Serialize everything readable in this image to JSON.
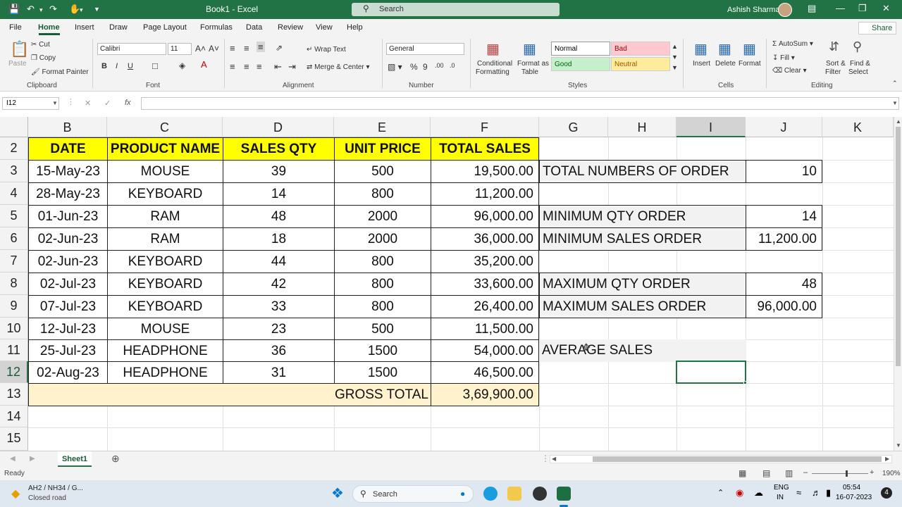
{
  "window": {
    "title": "Book1 - Excel",
    "search_placeholder": "Search",
    "user": "Ashish Sharma",
    "quick_access": [
      "save-icon",
      "undo-icon",
      "redo-icon",
      "touch-mode-icon",
      "customize-icon"
    ]
  },
  "ribbon_tabs": [
    "File",
    "Home",
    "Insert",
    "Draw",
    "Page Layout",
    "Formulas",
    "Data",
    "Review",
    "View",
    "Help"
  ],
  "active_tab": "Home",
  "share_label": "Share",
  "ribbon": {
    "clipboard": {
      "paste": "Paste",
      "cut": "Cut",
      "copy": "Copy",
      "format_painter": "Format Painter",
      "group": "Clipboard"
    },
    "font": {
      "name": "Calibri",
      "size": "11",
      "group": "Font",
      "bold": "B",
      "italic": "I",
      "underline": "U"
    },
    "alignment": {
      "wrap_text": "Wrap Text",
      "merge_center": "Merge & Center",
      "group": "Alignment"
    },
    "number": {
      "format": "General",
      "group": "Number"
    },
    "styles": {
      "conditional_formatting": [
        "Conditional",
        "Formatting"
      ],
      "format_as_table": [
        "Format as",
        "Table"
      ],
      "normal": "Normal",
      "bad": "Bad",
      "good": "Good",
      "neutral": "Neutral",
      "group": "Styles"
    },
    "cells": {
      "insert": "Insert",
      "delete": "Delete",
      "format": "Format",
      "group": "Cells"
    },
    "editing": {
      "autosum": "AutoSum",
      "fill": "Fill",
      "clear": "Clear",
      "sort_filter": [
        "Sort &",
        "Filter"
      ],
      "find_select": [
        "Find &",
        "Select"
      ],
      "group": "Editing"
    },
    "colors": {
      "bad_bg": "#ffc7ce",
      "good_bg": "#c6efce",
      "neutral_bg": "#ffeb9c"
    }
  },
  "formula_bar": {
    "name_box": "I12",
    "fx": "fx",
    "content": ""
  },
  "columns": [
    "B",
    "C",
    "D",
    "E",
    "F",
    "G",
    "H",
    "I",
    "J",
    "K"
  ],
  "rows": [
    "2",
    "3",
    "4",
    "5",
    "6",
    "7",
    "8",
    "9",
    "10",
    "11",
    "12",
    "13",
    "14",
    "15"
  ],
  "selected_cell": "I12",
  "table": {
    "headers": [
      "DATE",
      "PRODUCT NAME",
      "SALES QTY",
      "UNIT PRICE",
      "TOTAL SALES"
    ],
    "rows": [
      [
        "15-May-23",
        "MOUSE",
        "39",
        "500",
        "19,500.00"
      ],
      [
        "28-May-23",
        "KEYBOARD",
        "14",
        "800",
        "11,200.00"
      ],
      [
        "01-Jun-23",
        "RAM",
        "48",
        "2000",
        "96,000.00"
      ],
      [
        "02-Jun-23",
        "RAM",
        "18",
        "2000",
        "36,000.00"
      ],
      [
        "02-Jun-23",
        "KEYBOARD",
        "44",
        "800",
        "35,200.00"
      ],
      [
        "02-Jul-23",
        "KEYBOARD",
        "42",
        "800",
        "33,600.00"
      ],
      [
        "07-Jul-23",
        "KEYBOARD",
        "33",
        "800",
        "26,400.00"
      ],
      [
        "12-Jul-23",
        "MOUSE",
        "23",
        "500",
        "11,500.00"
      ],
      [
        "25-Jul-23",
        "HEADPHONE",
        "36",
        "1500",
        "54,000.00"
      ],
      [
        "02-Aug-23",
        "HEADPHONE",
        "31",
        "1500",
        "46,500.00"
      ]
    ],
    "gross_total_label": "GROSS TOTAL",
    "gross_total_value": "3,69,900.00"
  },
  "summary": {
    "total_orders_label": "TOTAL NUMBERS OF ORDER",
    "total_orders_value": "10",
    "min_qty_label": "MINIMUM QTY ORDER",
    "min_qty_value": "14",
    "min_sales_label": "MINIMUM SALES ORDER",
    "min_sales_value": "11,200.00",
    "max_qty_label": "MAXIMUM QTY ORDER",
    "max_qty_value": "48",
    "max_sales_label": "MAXIMUM SALES ORDER",
    "max_sales_value": "96,000.00",
    "avg_sales_label": "AVERAGE SALES"
  },
  "sheets": [
    "Sheet1"
  ],
  "status": {
    "ready": "Ready",
    "zoom": "190%"
  },
  "taskbar": {
    "weather_title": "AH2 / NH34 / G...",
    "weather_sub": "Closed road",
    "search": "Search",
    "lang1": "ENG",
    "lang2": "IN",
    "time": "05:54",
    "date": "16-07-2023",
    "notification_count": "4"
  },
  "theme": {
    "excel_green": "#217346",
    "header_yellow": "#ffff00",
    "total_tan": "#fff2cc"
  }
}
